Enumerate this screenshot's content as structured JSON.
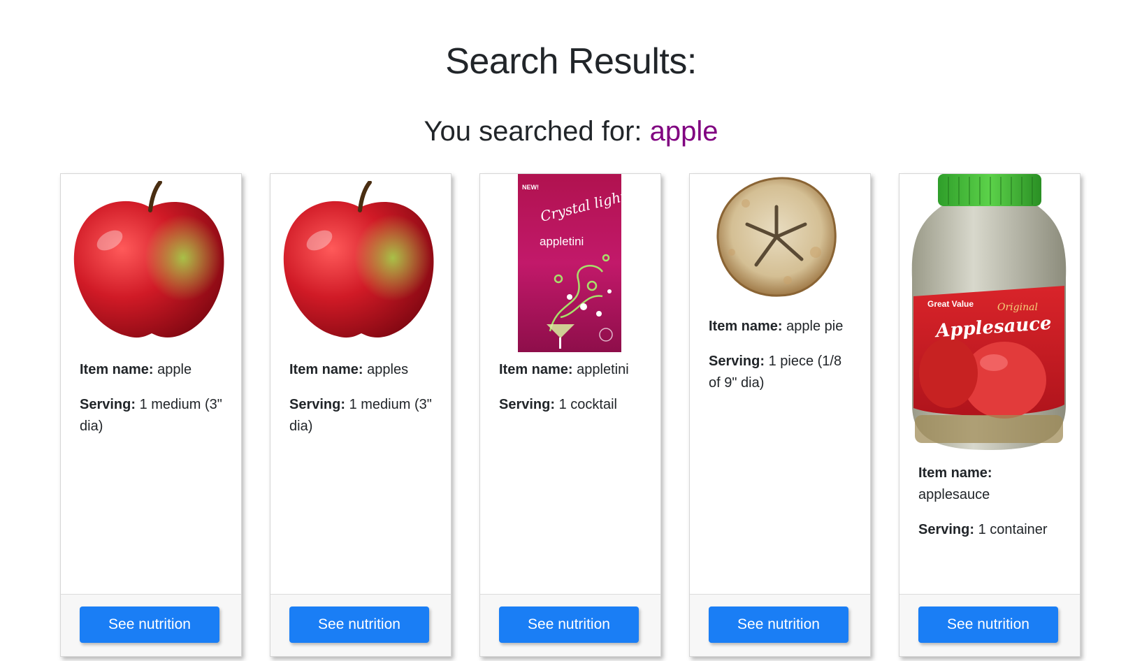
{
  "header": {
    "title": "Search Results:",
    "search_prefix": "You searched for: ",
    "search_term": "apple"
  },
  "results": [
    {
      "item_label": "Item name:",
      "item_value": "apple",
      "serving_label": "Serving:",
      "serving_value": "1 medium (3\" dia)",
      "button_label": "See nutrition",
      "image": "apple-photo"
    },
    {
      "item_label": "Item name:",
      "item_value": "apples",
      "serving_label": "Serving:",
      "serving_value": "1 medium (3\" dia)",
      "button_label": "See nutrition",
      "image": "apple-photo"
    },
    {
      "item_label": "Item name:",
      "item_value": "appletini",
      "serving_label": "Serving:",
      "serving_value": "1 cocktail",
      "button_label": "See nutrition",
      "image": "crystal-light-packet",
      "packet_brand": "Crystal light",
      "packet_flavor": "appletini",
      "packet_badge": "NEW!"
    },
    {
      "item_label": "Item name:",
      "item_value": "apple pie",
      "serving_label": "Serving:",
      "serving_value": "1 piece (1/8 of 9\" dia)",
      "button_label": "See nutrition",
      "image": "apple-pie-photo"
    },
    {
      "item_label": "Item name:",
      "item_value": "applesauce",
      "serving_label": "Serving:",
      "serving_value": "1 container",
      "button_label": "See nutrition",
      "image": "applesauce-jar",
      "jar_brand": "Great Value",
      "jar_variant": "Original",
      "jar_product": "Applesauce"
    }
  ],
  "colors": {
    "search_term": "#800080",
    "button": "#1a7ef5",
    "footer": "#f7f7f7"
  }
}
